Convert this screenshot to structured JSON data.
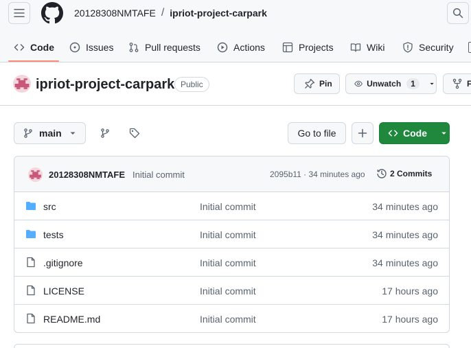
{
  "header": {
    "owner": "20128308NMTAFE",
    "separator": "/",
    "repo": "ipriot-project-carpark"
  },
  "tabs": [
    {
      "label": "Code",
      "icon": "code-icon"
    },
    {
      "label": "Issues",
      "icon": "issue-opened-icon"
    },
    {
      "label": "Pull requests",
      "icon": "git-pull-request-icon"
    },
    {
      "label": "Actions",
      "icon": "play-icon"
    },
    {
      "label": "Projects",
      "icon": "table-icon"
    },
    {
      "label": "Wiki",
      "icon": "book-icon"
    },
    {
      "label": "Security",
      "icon": "shield-icon"
    }
  ],
  "repo_title": {
    "name": "ipriot-project-carpark",
    "visibility": "Public",
    "pin_label": "Pin",
    "watch_label": "Unwatch",
    "watch_count": "1",
    "fork_label": "F"
  },
  "toolbar": {
    "branch": "main",
    "goto_file": "Go to file",
    "code_label": "Code"
  },
  "latest_commit": {
    "author": "20128308NMTAFE",
    "message": "Initial commit",
    "meta": "2095b11 · 34 minutes ago",
    "commits_label": "2 Commits"
  },
  "files": [
    {
      "name": "src",
      "type": "folder",
      "message": "Initial commit",
      "time": "34 minutes ago"
    },
    {
      "name": "tests",
      "type": "folder",
      "message": "Initial commit",
      "time": "34 minutes ago"
    },
    {
      "name": ".gitignore",
      "type": "file",
      "message": "Initial commit",
      "time": "34 minutes ago"
    },
    {
      "name": "LICENSE",
      "type": "file",
      "message": "Initial commit",
      "time": "17 hours ago"
    },
    {
      "name": "README.md",
      "type": "file",
      "message": "Initial commit",
      "time": "17 hours ago"
    }
  ],
  "colors": {
    "accent_underline": "#fd8c73",
    "code_button": "#1f883d",
    "folder": "#54aeff"
  }
}
